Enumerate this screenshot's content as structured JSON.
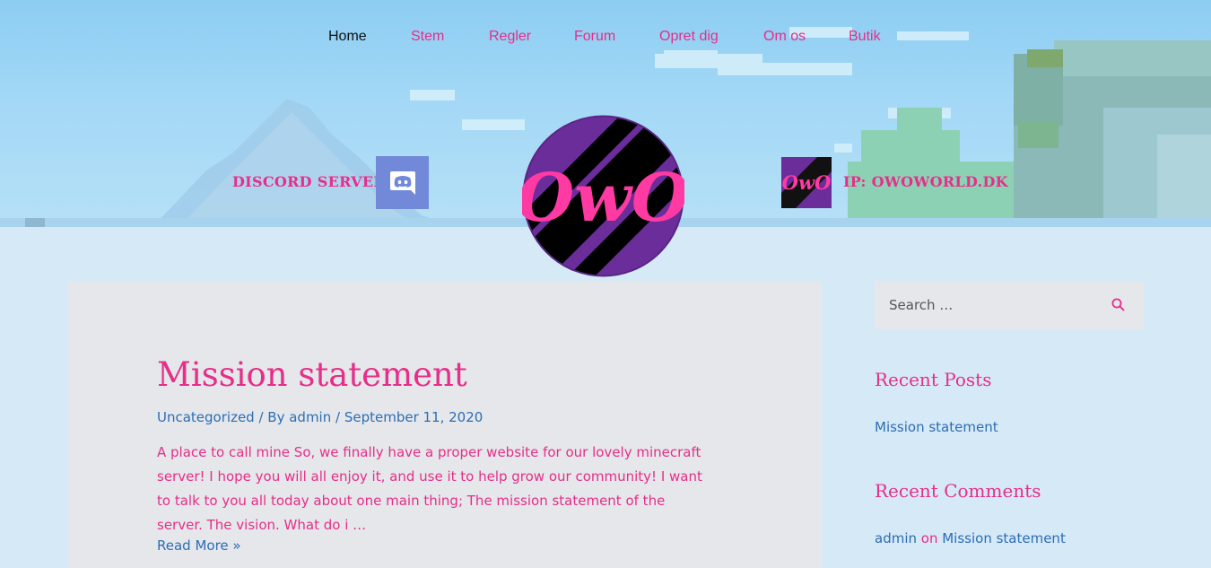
{
  "nav": {
    "items": [
      {
        "label": "Home",
        "active": true
      },
      {
        "label": "Stem"
      },
      {
        "label": "Regler"
      },
      {
        "label": "Forum"
      },
      {
        "label": "Opret dig"
      },
      {
        "label": "Om os"
      },
      {
        "label": "Butik"
      }
    ]
  },
  "hero": {
    "discord_label": "DISCORD SERVER",
    "discord_icon": "discord-icon",
    "ip_label": "IP: OWOWORLD.DK",
    "logo_text": "OwO",
    "ip_logo_text": "OwO"
  },
  "post": {
    "title": "Mission statement",
    "category": "Uncategorized",
    "by_prefix": " / By ",
    "author": "admin",
    "date_sep": " / ",
    "date": "September 11, 2020",
    "excerpt": "A place to call mine So, we finally have a proper website for our lovely minecraft server! I hope you will all enjoy it, and use it to help grow our community! I want to talk to you all today about one main thing; The mission statement of the server. The vision. What do i …",
    "read_more": "Read More »"
  },
  "sidebar": {
    "search_placeholder": "Search …",
    "search_icon": "search-icon",
    "recent_posts_title": "Recent Posts",
    "recent_posts": [
      "Mission statement"
    ],
    "recent_comments_title": "Recent Comments",
    "comment_author": "admin",
    "comment_on": " on ",
    "comment_post": "Mission statement"
  },
  "colors": {
    "accent_pink": "#e62e8a",
    "link_blue": "#2d6db5",
    "discord_blurple": "#7289da",
    "logo_purple": "#6a2d9a"
  }
}
